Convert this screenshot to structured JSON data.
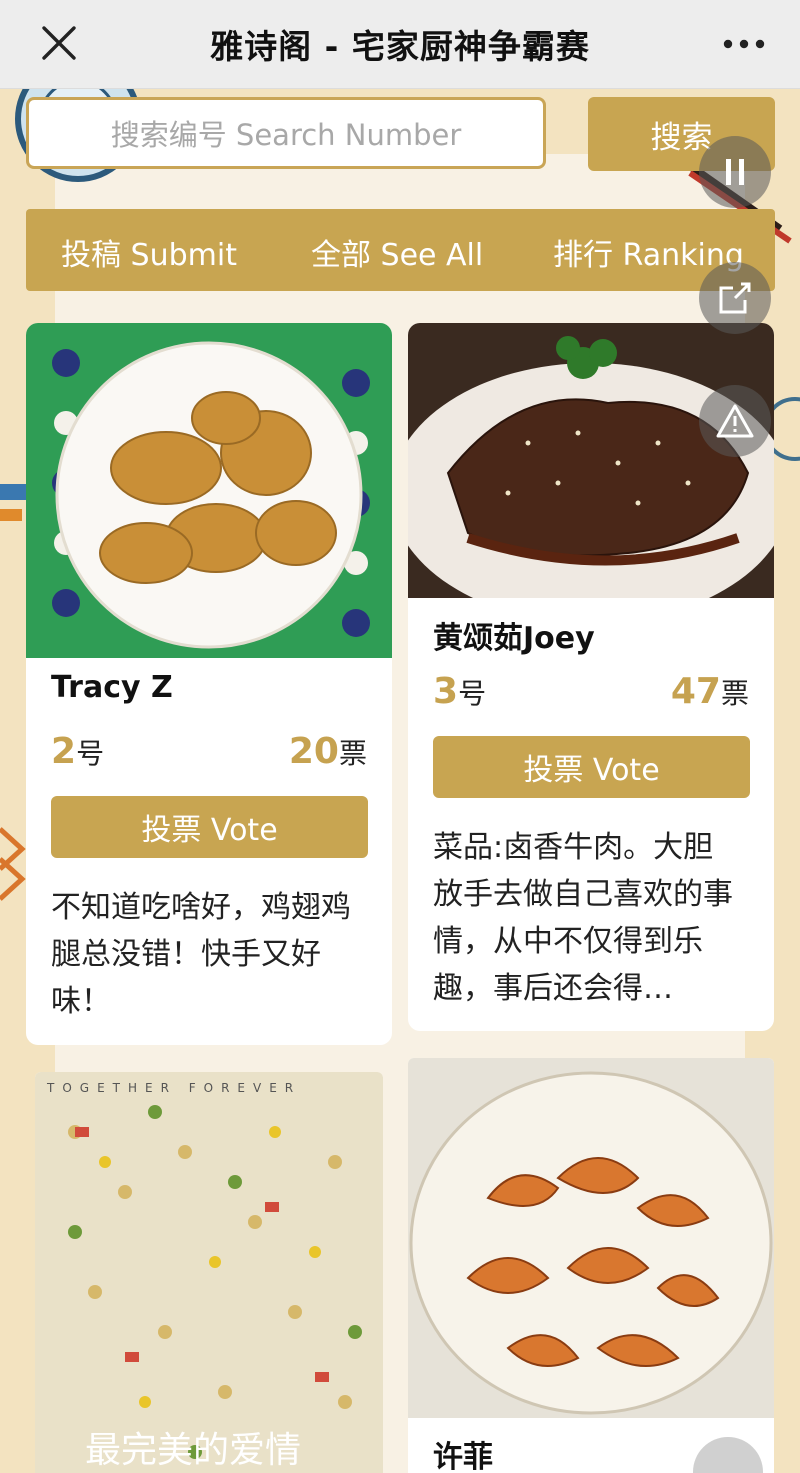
{
  "topbar": {
    "title": "雅诗阁 - 宅家厨神争霸赛"
  },
  "search": {
    "placeholder": "搜索编号 Search Number",
    "button": "搜索"
  },
  "nav": {
    "submit": "投稿 Submit",
    "see_all": "全部 See All",
    "ranking": "排行 Ranking"
  },
  "colors": {
    "accent": "#c8a551",
    "background": "#f3e3c0"
  },
  "entries": [
    {
      "name": "Tracy Z",
      "number": "2",
      "number_suffix": "号",
      "votes": "20",
      "votes_suffix": "票",
      "vote_label": "投票 Vote",
      "description": "不知道吃啥好，鸡翅鸡腿总没错！快手又好味！"
    },
    {
      "name": "黄颂茹Joey",
      "number": "3",
      "number_suffix": "号",
      "votes": "47",
      "votes_suffix": "票",
      "vote_label": "投票 Vote",
      "description": "菜品:卤香牛肉。大胆放手去做自己喜欢的事情，从中不仅得到乐趣，事后还会得…"
    },
    {
      "name": "",
      "photo_text_top": "TOGETHER FOREVER",
      "photo_text_bottom": "最完美的爱情"
    },
    {
      "name": "许菲"
    }
  ],
  "icons": [
    "close-icon",
    "more-icon",
    "pause-icon",
    "share-icon",
    "warning-icon"
  ]
}
